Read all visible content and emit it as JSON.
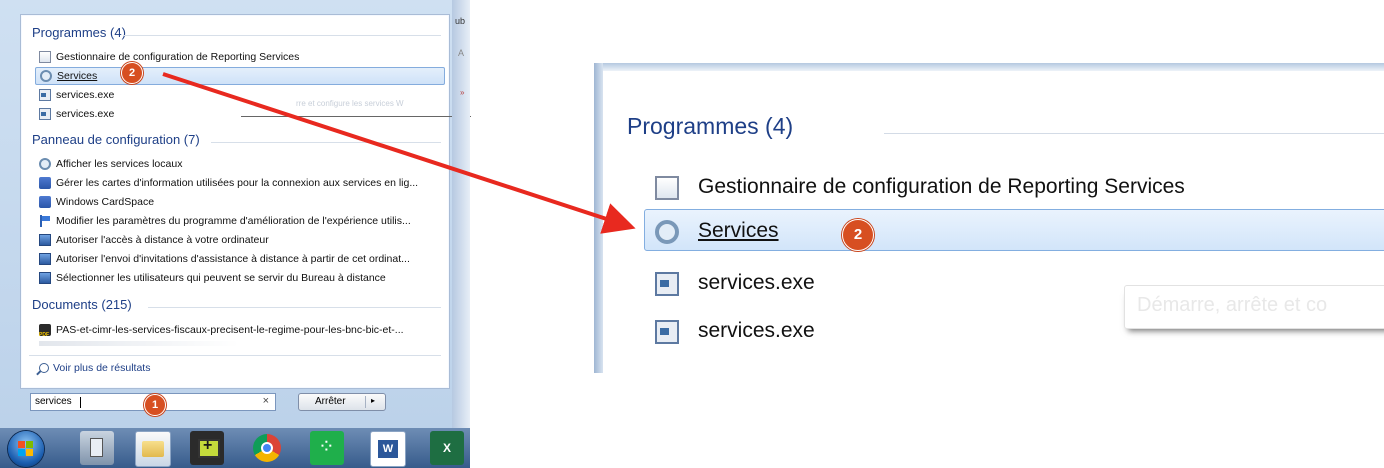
{
  "start_menu": {
    "right_fragments": [
      "ub",
      "A",
      "»"
    ],
    "groups": {
      "programs": {
        "title": "Programmes (4)"
      },
      "control_panel": {
        "title": "Panneau de configuration (7)"
      },
      "documents": {
        "title": "Documents (215)"
      }
    },
    "programs_items": [
      {
        "label": "Gestionnaire de configuration de Reporting Services",
        "icon": "config-wizard-icon"
      },
      {
        "label": "Services",
        "icon": "services-gear-icon",
        "selected": true
      },
      {
        "label": "services.exe",
        "icon": "exe-window-icon"
      },
      {
        "label": "services.exe",
        "icon": "exe-window-icon"
      }
    ],
    "background_tooltip": "rre et configure les services W",
    "control_panel_items": [
      {
        "label": "Afficher les services locaux",
        "icon": "services-gear-icon"
      },
      {
        "label": "Gérer les cartes d'information utilisées pour la connexion aux services en lig...",
        "icon": "cardspace-icon"
      },
      {
        "label": "Windows CardSpace",
        "icon": "cardspace-icon"
      },
      {
        "label": "Modifier les paramètres du programme d'amélioration de l'expérience utilis...",
        "icon": "flag-icon"
      },
      {
        "label": "Autoriser l'accès à distance à votre ordinateur",
        "icon": "remote-desktop-icon"
      },
      {
        "label": "Autoriser l'envoi d'invitations d'assistance à distance à partir de cet ordinat...",
        "icon": "remote-desktop-icon"
      },
      {
        "label": "Sélectionner les utilisateurs qui peuvent se servir du Bureau à distance",
        "icon": "remote-desktop-icon"
      }
    ],
    "documents_items": [
      {
        "label": "PAS-et-cimr-les-services-fiscaux-precisent-le-regime-pour-les-bnc-bic-et-...",
        "icon": "pdf-icon"
      }
    ],
    "see_more": "Voir plus de résultats",
    "search": {
      "value": "services",
      "clear": "×"
    },
    "stop_button": {
      "label": "Arrêter",
      "arrow": "▸"
    }
  },
  "badges": {
    "step1": "1",
    "step2": "2"
  },
  "taskbar": {
    "items": [
      "start-orb",
      "calculator-icon",
      "explorer-folder-icon",
      "add-app-icon",
      "chrome-icon",
      "green-app-icon",
      "word-icon",
      "excel-icon"
    ]
  },
  "zoom": {
    "group_title": "Programmes (4)",
    "items": [
      {
        "label": "Gestionnaire de configuration de Reporting Services"
      },
      {
        "label": "Services",
        "selected": true
      },
      {
        "label": "services.exe"
      },
      {
        "label": "services.exe"
      }
    ],
    "tooltip": "Démarre, arrête et co"
  },
  "colors": {
    "badge": "#d74f21",
    "arrow": "#e8291f",
    "group_title": "#1e3f87",
    "selection": "#d2e5fa"
  }
}
